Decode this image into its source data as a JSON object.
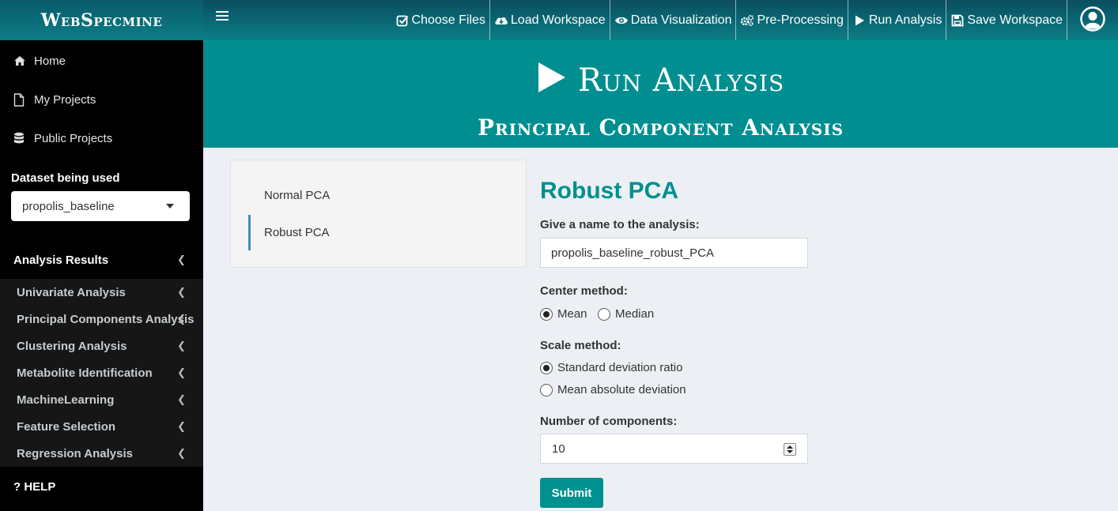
{
  "app": {
    "logo": "WebSpecmine"
  },
  "topnav": {
    "items": [
      {
        "label": "Choose Files",
        "icon": "check-square-icon"
      },
      {
        "label": "Load Workspace",
        "icon": "cloud-download-icon"
      },
      {
        "label": "Data Visualization",
        "icon": "eye-icon"
      },
      {
        "label": "Pre-Processing",
        "icon": "gears-icon"
      },
      {
        "label": "Run Analysis",
        "icon": "play-icon"
      },
      {
        "label": "Save Workspace",
        "icon": "floppy-disk-icon"
      }
    ],
    "user_icon": "user-circle-icon"
  },
  "sidebar": {
    "links": [
      {
        "label": "Home",
        "icon": "home-icon"
      },
      {
        "label": "My Projects",
        "icon": "file-icon"
      },
      {
        "label": "Public Projects",
        "icon": "database-icon"
      }
    ],
    "dataset_label": "Dataset being used",
    "dataset_value": "propolis_baseline",
    "results_header": "Analysis Results",
    "results_items": [
      "Univariate Analysis",
      "Principal Components Analysis",
      "Clustering Analysis",
      "Metabolite Identification",
      "MachineLearning",
      "Feature Selection",
      "Regression Analysis"
    ],
    "help": "? HELP"
  },
  "banner": {
    "title": "Run Analysis",
    "subtitle": "Principal Component Analysis"
  },
  "tabs": [
    {
      "label": "Normal PCA",
      "active": false
    },
    {
      "label": "Robust PCA",
      "active": true
    }
  ],
  "form": {
    "title": "Robust PCA",
    "name_label": "Give a name to the analysis:",
    "name_value": "propolis_baseline_robust_PCA",
    "center_label": "Center method:",
    "center_options": [
      "Mean",
      "Median"
    ],
    "center_selected": "Mean",
    "scale_label": "Scale method:",
    "scale_options": [
      "Standard deviation ratio",
      "Mean absolute deviation"
    ],
    "scale_selected": "Standard deviation ratio",
    "components_label": "Number of components:",
    "components_value": "10",
    "submit_label": "Submit"
  },
  "colors": {
    "accent": "#00908f",
    "header": "#0b7e86",
    "sidebar": "#000000",
    "active_tab_border": "#3c8dbc"
  }
}
